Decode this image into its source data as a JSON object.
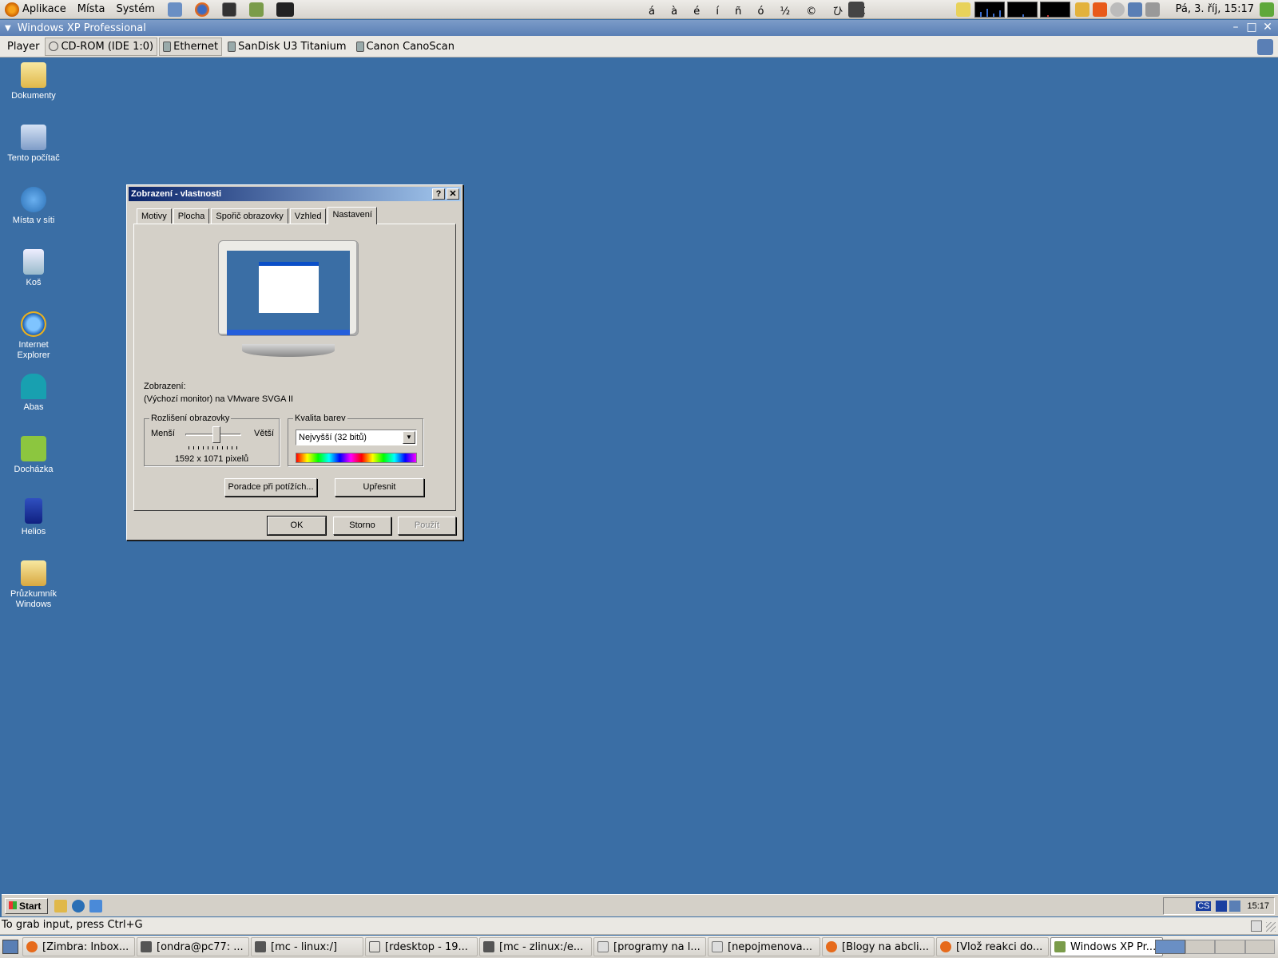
{
  "top_panel": {
    "menus": [
      "Aplikace",
      "Místa",
      "Systém"
    ],
    "special_chars": "á à é í ñ ó ½ © ひ €",
    "clock": "Pá,  3. říj, 15:17"
  },
  "vm_window": {
    "title": "Windows XP Professional",
    "toolbar": [
      "Player",
      "CD-ROM (IDE 1:0)",
      "Ethernet",
      "SanDisk U3 Titanium",
      "Canon CanoScan"
    ]
  },
  "desktop_icons": [
    {
      "label": "Dokumenty"
    },
    {
      "label": "Tento počítač"
    },
    {
      "label": "Místa v síti"
    },
    {
      "label": "Koš"
    },
    {
      "label": "Internet Explorer"
    },
    {
      "label": "Abas"
    },
    {
      "label": "Docházka"
    },
    {
      "label": "Helios"
    },
    {
      "label": "Průzkumník Windows"
    }
  ],
  "dialog": {
    "title": "Zobrazení - vlastnosti",
    "help_btn": "?",
    "close_btn": "✕",
    "tabs": [
      "Motivy",
      "Plocha",
      "Spořič obrazovky",
      "Vzhled",
      "Nastavení"
    ],
    "display_label": "Zobrazení:",
    "display_value": "(Výchozí monitor) na VMware SVGA II",
    "resolution": {
      "legend": "Rozlišení obrazovky",
      "less": "Menší",
      "more": "Větší",
      "value": "1592 x 1071 pixelů",
      "slider_fraction": 0.55
    },
    "color_quality": {
      "legend": "Kvalita barev",
      "selected": "Nejvyšší (32 bitů)"
    },
    "troubleshoot_btn": "Poradce při potížích...",
    "advanced_btn": "Upřesnit",
    "ok_btn": "OK",
    "cancel_btn": "Storno",
    "apply_btn": "Použít"
  },
  "xp_taskbar": {
    "start": "Start",
    "lang": "CS",
    "clock": "15:17"
  },
  "status_line": "To grab input, press Ctrl+G",
  "bottom_tasks": [
    "[Zimbra: Inbox...",
    "[ondra@pc77: ...",
    "[mc - linux:/]",
    "[rdesktop - 19...",
    "[mc - zlinux:/e...",
    "[programy na l...",
    "[nepojmenova...",
    "[Blogy na abcli...",
    "[Vlož reakci do...",
    "Windows XP Pr..."
  ]
}
